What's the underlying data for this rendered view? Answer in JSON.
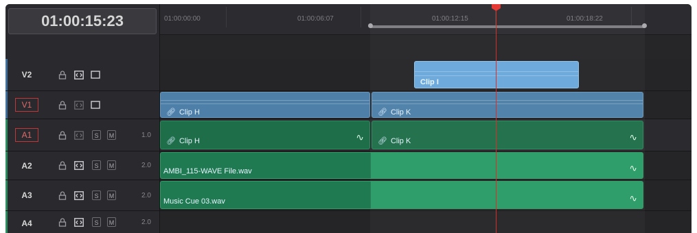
{
  "timecode": "01:00:15:23",
  "ruler": {
    "ticks": [
      "01:00:00:00",
      "01:00:06:07",
      "01:00:12:15",
      "01:00:18:22"
    ]
  },
  "tracks": [
    {
      "id": "V2",
      "kind": "video",
      "selected": false
    },
    {
      "id": "V1",
      "kind": "video",
      "selected": true
    },
    {
      "id": "A1",
      "kind": "audio",
      "selected": true,
      "level": "1.0",
      "solo_label": "S",
      "mute_label": "M"
    },
    {
      "id": "A2",
      "kind": "audio",
      "selected": false,
      "level": "2.0",
      "solo_label": "S",
      "mute_label": "M"
    },
    {
      "id": "A3",
      "kind": "audio",
      "selected": false,
      "level": "2.0",
      "solo_label": "S",
      "mute_label": "M"
    },
    {
      "id": "A4",
      "kind": "audio",
      "selected": false,
      "level": "2.0",
      "solo_label": "S",
      "mute_label": "M"
    }
  ],
  "clips": {
    "v2_clip_i": "Clip I",
    "v1_clip_h": "Clip H",
    "v1_clip_k": "Clip K",
    "a1_clip_h": "Clip H",
    "a1_clip_k": "Clip K",
    "a2_clip": "AMBI_115-WAVE File.wav",
    "a3_clip": "Music Cue 03.wav"
  },
  "icons": {
    "lock": "lock-icon",
    "auto_select": "auto-select-icon",
    "video_toggle": "enable-track-icon",
    "link": "link-icon",
    "waveform": "waveform-icon"
  },
  "colors": {
    "video_clip": "#4d7fa8",
    "video_clip_top": "#6aa9db",
    "audio_clip": "#1f7a52",
    "audio_clip_bright": "#2a9b66",
    "playhead": "#e53935",
    "selected_track_outline": "#c0383a"
  }
}
